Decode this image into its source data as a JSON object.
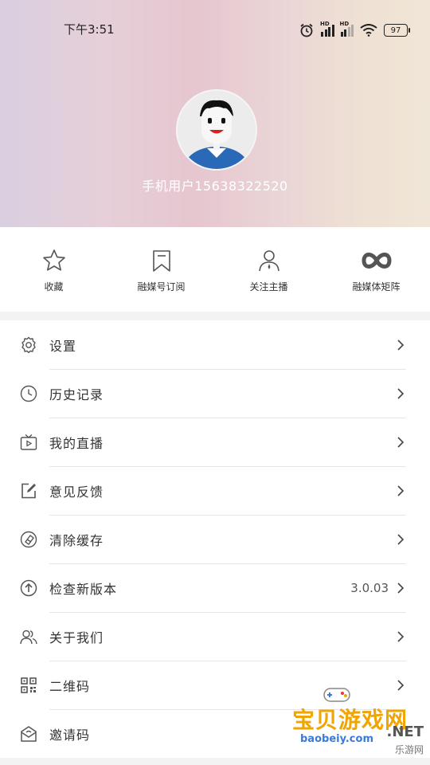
{
  "status_bar": {
    "time": "下午3:51",
    "battery": "97",
    "signal1": "HD",
    "signal2": "HD"
  },
  "profile": {
    "username": "手机用户15638322520"
  },
  "quick_actions": [
    {
      "label": "收藏",
      "icon": "star-icon"
    },
    {
      "label": "融媒号订阅",
      "icon": "bookmark-icon"
    },
    {
      "label": "关注主播",
      "icon": "person-icon"
    },
    {
      "label": "融媒体矩阵",
      "icon": "infinity-icon"
    }
  ],
  "menu": [
    {
      "label": "设置",
      "icon": "gear-icon",
      "value": ""
    },
    {
      "label": "历史记录",
      "icon": "clock-icon",
      "value": ""
    },
    {
      "label": "我的直播",
      "icon": "tv-icon",
      "value": ""
    },
    {
      "label": "意见反馈",
      "icon": "edit-icon",
      "value": ""
    },
    {
      "label": "清除缓存",
      "icon": "eraser-icon",
      "value": ""
    },
    {
      "label": "检查新版本",
      "icon": "upload-icon",
      "value": "3.0.03"
    },
    {
      "label": "关于我们",
      "icon": "users-icon",
      "value": ""
    },
    {
      "label": "二维码",
      "icon": "qrcode-icon",
      "value": ""
    },
    {
      "label": "邀请码",
      "icon": "invite-icon",
      "value": ""
    }
  ],
  "watermark": {
    "title": "宝贝游戏网",
    "url": "baobeiy.com",
    "net": ".NET",
    "sub": "乐游网"
  }
}
